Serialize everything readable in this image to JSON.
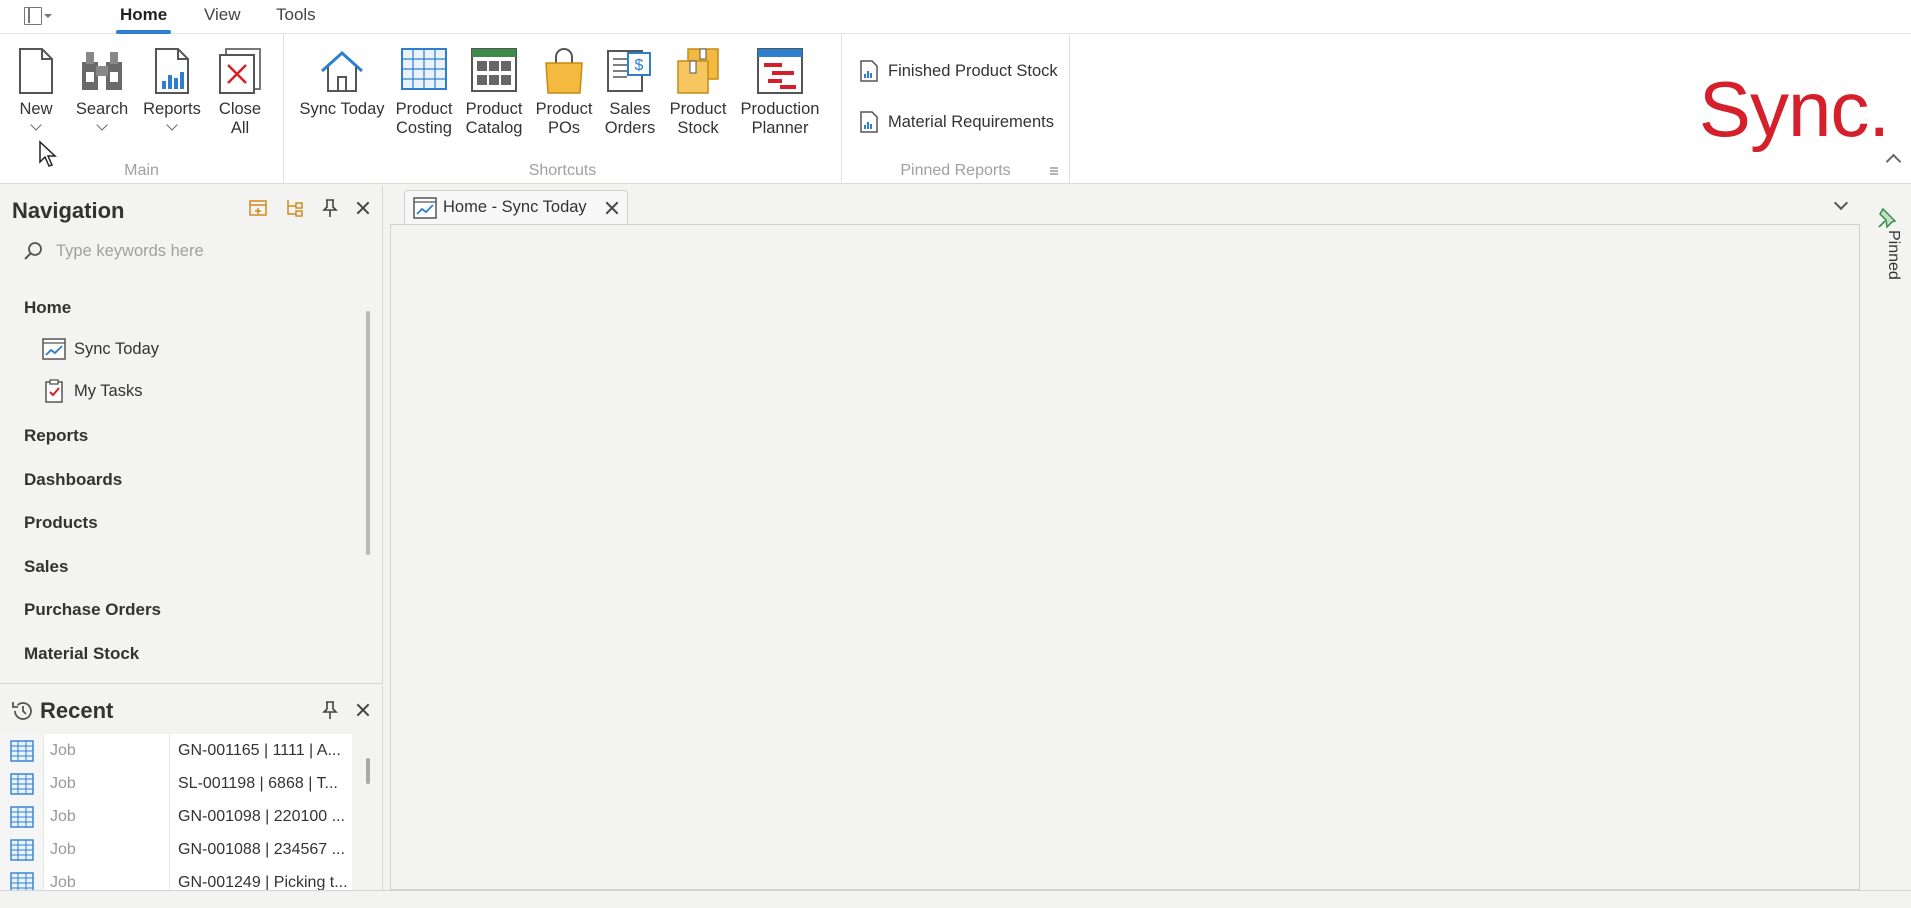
{
  "menubar": {
    "tabs": [
      {
        "label": "Home",
        "active": true
      },
      {
        "label": "View",
        "active": false
      },
      {
        "label": "Tools",
        "active": false
      }
    ]
  },
  "ribbon": {
    "main": {
      "label": "Main",
      "new_label": "New",
      "search_label": "Search",
      "reports_label": "Reports",
      "close_all_line1": "Close",
      "close_all_line2": "All"
    },
    "shortcuts": {
      "label": "Shortcuts",
      "items": [
        {
          "line1": "Sync Today",
          "line2": ""
        },
        {
          "line1": "Product",
          "line2": "Costing"
        },
        {
          "line1": "Product",
          "line2": "Catalog"
        },
        {
          "line1": "Product",
          "line2": "POs"
        },
        {
          "line1": "Sales",
          "line2": "Orders"
        },
        {
          "line1": "Product",
          "line2": "Stock"
        },
        {
          "line1": "Production",
          "line2": "Planner"
        }
      ]
    },
    "pinned_reports": {
      "label": "Pinned Reports",
      "items": [
        "Finished Product Stock",
        "Material Requirements"
      ]
    },
    "logo_text": "Sync."
  },
  "navigation": {
    "title": "Navigation",
    "search_placeholder": "Type keywords here",
    "home_label": "Home",
    "home_items": [
      "Sync Today",
      "My Tasks"
    ],
    "sections": [
      "Reports",
      "Dashboards",
      "Products",
      "Sales",
      "Purchase Orders",
      "Material Stock"
    ]
  },
  "recent": {
    "title": "Recent",
    "rows": [
      {
        "type": "Job",
        "desc": "GN-001165 | 1111 | A..."
      },
      {
        "type": "Job",
        "desc": "SL-001198 | 6868 | T..."
      },
      {
        "type": "Job",
        "desc": "GN-001098 | 220100 ..."
      },
      {
        "type": "Job",
        "desc": "GN-001088 | 234567 ..."
      },
      {
        "type": "Job",
        "desc": "GN-001249 | Picking t..."
      }
    ]
  },
  "document": {
    "tab_label": "Home - Sync Today"
  },
  "rail": {
    "label": "Pinned"
  },
  "colors": {
    "accent": "#2f7fd1",
    "logo": "#d51f2a"
  }
}
